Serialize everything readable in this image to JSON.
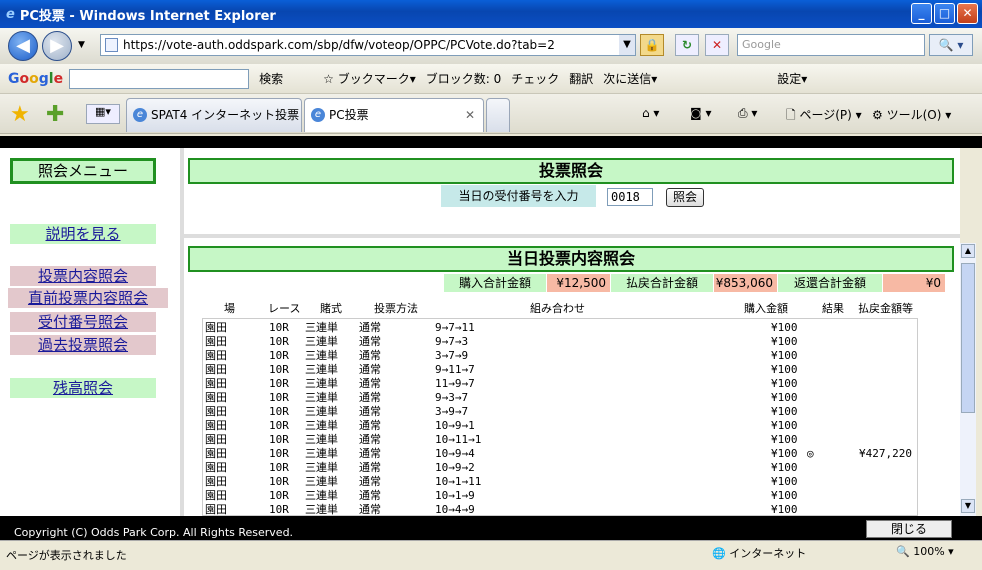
{
  "window": {
    "title": "PC投票 - Windows Internet Explorer"
  },
  "address": {
    "url": "https://vote-auth.oddspark.com/sbp/dfw/voteop/OPPC/PCVote.do?tab=2",
    "search_placeholder": "Google"
  },
  "google_bar": {
    "search_btn": "検索",
    "bookmark": "ブックマーク▾",
    "block": "ブロック数: 0",
    "check": "チェック",
    "translate": "翻訳",
    "send": "次に送信▾",
    "settings": "設定▾"
  },
  "tabs": [
    {
      "label": "SPAT4 インターネット投票"
    },
    {
      "label": "PC投票"
    }
  ],
  "toolbar": {
    "page": "ページ(P)",
    "tools": "ツール(O)"
  },
  "menu": {
    "title": "照会メニュー",
    "help": "説明を見る",
    "vote_inquiry": "投票内容照会",
    "recent_inquiry": "直前投票内容照会",
    "receipt_inquiry": "受付番号照会",
    "past_inquiry": "過去投票照会",
    "balance": "残高照会"
  },
  "inquiry": {
    "title": "投票照会",
    "label": "当日の受付番号を入力",
    "value": "0018",
    "button": "照会"
  },
  "today": {
    "title": "当日投票内容照会",
    "purchase_label": "購入合計金額",
    "purchase_value": "¥12,500",
    "payout_label": "払戻合計金額",
    "payout_value": "¥853,060",
    "refund_label": "返還合計金額",
    "refund_value": "¥0"
  },
  "columns": [
    "場",
    "レース",
    "賭式",
    "投票方法",
    "組み合わせ",
    "購入金額",
    "結果",
    "払戻金額等"
  ],
  "rows": [
    [
      "園田",
      "10R",
      "三連単",
      "通常",
      "9→7→11",
      "¥100",
      "",
      ""
    ],
    [
      "園田",
      "10R",
      "三連単",
      "通常",
      "9→7→3",
      "¥100",
      "",
      ""
    ],
    [
      "園田",
      "10R",
      "三連単",
      "通常",
      "3→7→9",
      "¥100",
      "",
      ""
    ],
    [
      "園田",
      "10R",
      "三連単",
      "通常",
      "9→11→7",
      "¥100",
      "",
      ""
    ],
    [
      "園田",
      "10R",
      "三連単",
      "通常",
      "11→9→7",
      "¥100",
      "",
      ""
    ],
    [
      "園田",
      "10R",
      "三連単",
      "通常",
      "9→3→7",
      "¥100",
      "",
      ""
    ],
    [
      "園田",
      "10R",
      "三連単",
      "通常",
      "3→9→7",
      "¥100",
      "",
      ""
    ],
    [
      "園田",
      "10R",
      "三連単",
      "通常",
      "10→9→1",
      "¥100",
      "",
      ""
    ],
    [
      "園田",
      "10R",
      "三連単",
      "通常",
      "10→11→1",
      "¥100",
      "",
      ""
    ],
    [
      "園田",
      "10R",
      "三連単",
      "通常",
      "10→9→4",
      "¥100",
      "◎",
      "¥427,220"
    ],
    [
      "園田",
      "10R",
      "三連単",
      "通常",
      "10→9→2",
      "¥100",
      "",
      ""
    ],
    [
      "園田",
      "10R",
      "三連単",
      "通常",
      "10→1→11",
      "¥100",
      "",
      ""
    ],
    [
      "園田",
      "10R",
      "三連単",
      "通常",
      "10→1→9",
      "¥100",
      "",
      ""
    ],
    [
      "園田",
      "10R",
      "三連単",
      "通常",
      "10→4→9",
      "¥100",
      "",
      ""
    ]
  ],
  "footer": {
    "copyright": "Copyright (C) Odds Park Corp. All Rights Reserved.",
    "close": "閉じる"
  },
  "status": {
    "text": "ページが表示されました",
    "zone": "インターネット",
    "zoom": "100%"
  }
}
